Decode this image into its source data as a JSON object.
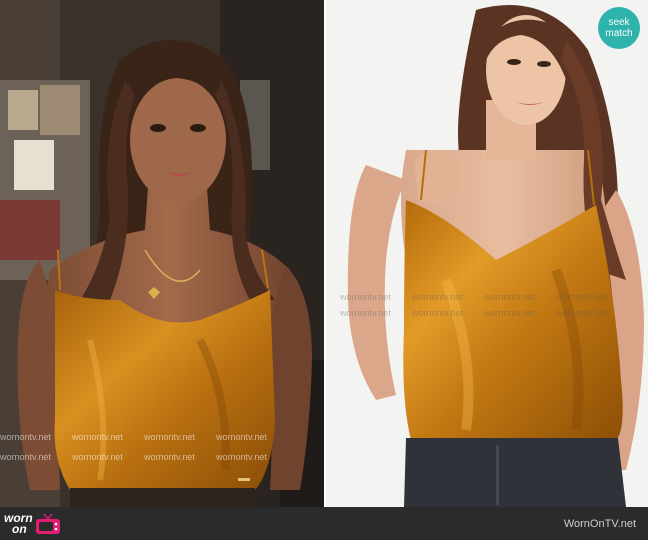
{
  "badge": {
    "line1": "seek",
    "line2": "match"
  },
  "watermark": {
    "text": "wornontv.net"
  },
  "footer": {
    "logo_word1": "worn",
    "logo_word2": "on",
    "logo_icon": "tv-icon",
    "site_name": "WornOnTV.net"
  },
  "colors": {
    "badge": "#2fb3ad",
    "footer_bg": "#2b2b2b",
    "garment": "#c07a12",
    "logo_tv": "#e11d74"
  }
}
